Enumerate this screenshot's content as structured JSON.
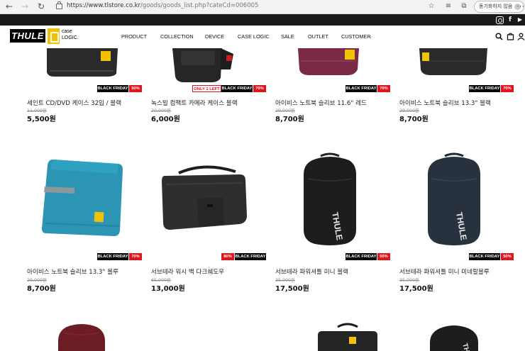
{
  "browser": {
    "url_host": "https://www.tlstore.co.kr",
    "url_path": "/goods/goods_list.php?cateCd=006005",
    "sync_label": "동기화하지 않음"
  },
  "social": {
    "instagram": "instagram-icon",
    "facebook": "f",
    "youtube": "▶"
  },
  "header": {
    "logo_thule": "THULE",
    "logo_case_line1": "case",
    "logo_case_line2": "LOGIC.",
    "menu": [
      "PRODUCT",
      "COLLECTION",
      "DEVICE",
      "CASE LOGIC",
      "SALE",
      "OUTLET",
      "CUSTOMER"
    ]
  },
  "colors": {
    "sale_red": "#e1141b",
    "black_friday": "#000000",
    "top_bar": "#1b1b1b"
  },
  "products": [
    {
      "name": "세인트 CD/DVD 케이스 32입 / 블랙",
      "orig_price": "11,000원",
      "price": "5,500원",
      "badge_bf": "BLACK FRIDAY",
      "badge_pct": "50%"
    },
    {
      "name": "녹스빌 컴팩트 카메라 케이스 블랙",
      "orig_price": "20,000원",
      "price": "6,000원",
      "badge_only": "ONLY 1 LEFT",
      "badge_bf": "BLACK FRIDAY",
      "badge_pct": "70%"
    },
    {
      "name": "아이비스 노트북 슬리브 11.6\" 레드",
      "orig_price": "29,000원",
      "price": "8,700원",
      "badge_bf": "BLACK FRIDAY",
      "badge_pct": "70%"
    },
    {
      "name": "아이비스 노트북 슬리브 13.3\" 블랙",
      "orig_price": "29,000원",
      "price": "8,700원",
      "badge_bf": "BLACK FRIDAY",
      "badge_pct": "70%"
    },
    {
      "name": "아이비스 노트북 슬리브 13.3\" 블루",
      "orig_price": "29,000원",
      "price": "8,700원",
      "badge_bf": "BLACK FRIDAY",
      "badge_pct": "70%"
    },
    {
      "name": "서브테라 워시 백 다크쉐도우",
      "orig_price": "65,000원",
      "price": "13,000원",
      "badge_pct": "80%",
      "badge_bf": "BLACK FRIDAY"
    },
    {
      "name": "서브테라 파워셔틀 미니 블랙",
      "orig_price": "35,000원",
      "price": "17,500원",
      "badge_bf": "BLACK FRIDAY",
      "badge_pct": "50%"
    },
    {
      "name": "서브테라 파워셔틀 미니 미네랄블루",
      "orig_price": "35,000원",
      "price": "17,500원",
      "badge_bf": "BLACK FRIDAY",
      "badge_pct": "50%"
    }
  ]
}
